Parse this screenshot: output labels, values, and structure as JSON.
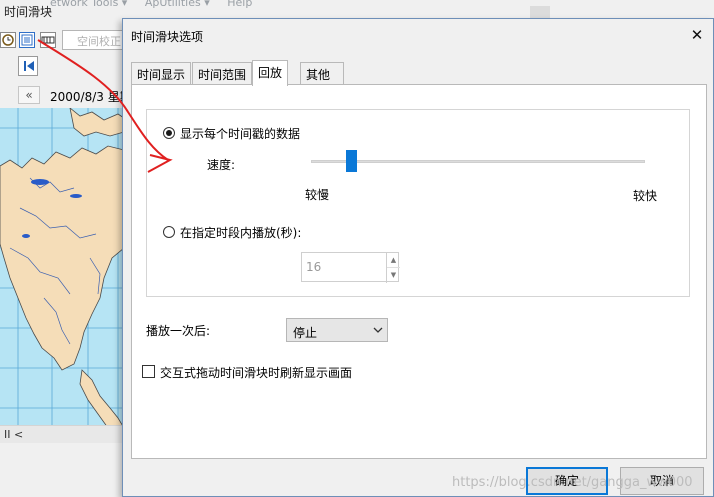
{
  "background_app": {
    "title": "时间滑块",
    "menu_ghost": [
      "etwork Tools ▾",
      "ApUtilities ▾",
      "Help"
    ],
    "address_placeholder": "空间校正",
    "date_label": "2000/8/3 星期",
    "collapse_label": "«",
    "scroll_label": "II  <"
  },
  "dialog": {
    "title": "时间滑块选项",
    "close_symbol": "✕",
    "tabs": [
      {
        "label": "时间显示",
        "active": false
      },
      {
        "label": "时间范围",
        "active": false
      },
      {
        "label": "回放",
        "active": true
      },
      {
        "label": "其他",
        "active": false
      }
    ],
    "playback": {
      "option_each_timestamp": {
        "label": "显示每个时间戳的数据",
        "checked": true
      },
      "speed_label": "速度:",
      "speed_min_label": "较慢",
      "speed_max_label": "较快",
      "speed_level": 0.12,
      "option_duration": {
        "label": "在指定时段内播放(秒):",
        "checked": false
      },
      "duration_value": "16",
      "after_play_label": "播放一次后:",
      "after_play_value": "停止",
      "interactive_refresh": {
        "label": "交互式拖动时间滑块时刷新显示画面",
        "checked": false
      }
    },
    "ok_label": "确定",
    "cancel_label": "取消"
  },
  "watermark": "https://blog.csdn.net/gangga_ww000",
  "colors": {
    "accent": "#0a78d7",
    "annotation": "#e02020",
    "water": "#b6e4f4",
    "land": "#f5ddb8"
  }
}
